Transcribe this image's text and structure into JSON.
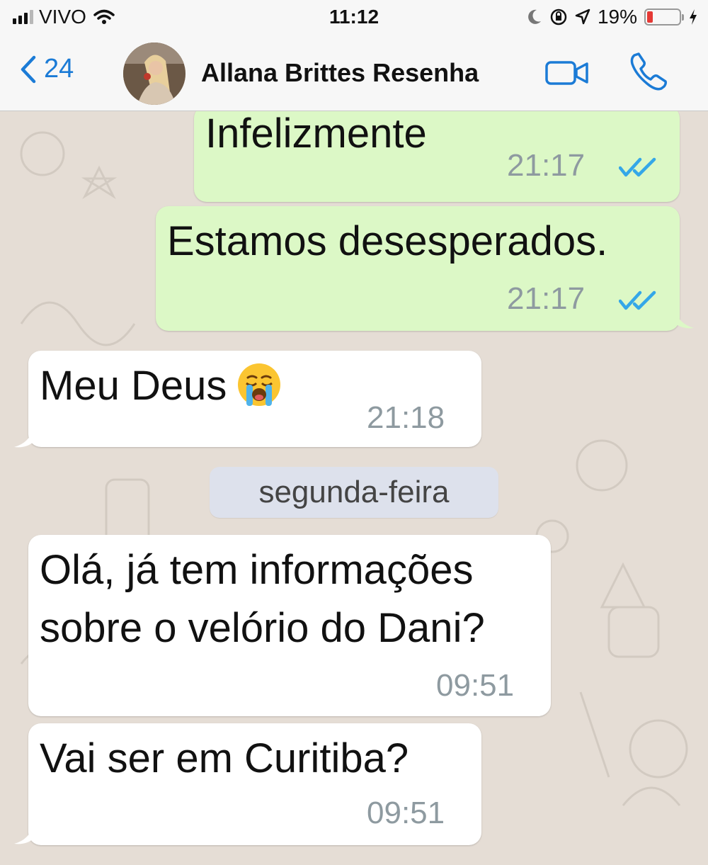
{
  "status_bar": {
    "carrier": "VIVO",
    "time": "11:12",
    "battery_percent": "19%",
    "battery_level": 0.19,
    "icons": [
      "signal-icon",
      "wifi-icon",
      "moon-icon",
      "orientation-lock-icon",
      "location-icon",
      "battery-icon",
      "charging-icon"
    ]
  },
  "header": {
    "back_count": "24",
    "contact_name": "Allana Brittes Resenha",
    "icons": [
      "back-chevron-icon",
      "avatar",
      "video-call-icon",
      "phone-call-icon"
    ]
  },
  "messages": [
    {
      "direction": "outgoing",
      "text": "Infelizmente",
      "time": "21:17",
      "status": "read"
    },
    {
      "direction": "outgoing",
      "text": "Estamos desesperados.",
      "time": "21:17",
      "status": "read"
    },
    {
      "direction": "incoming",
      "text": "Meu Deus",
      "emoji": "loudly-crying-face",
      "time": "21:18"
    },
    {
      "direction": "incoming",
      "text_line1": "Olá, já tem informações",
      "text_line2": "sobre o velório do Dani?",
      "time": "09:51"
    },
    {
      "direction": "incoming",
      "text": "Vai ser em Curitiba?",
      "time": "09:51"
    }
  ],
  "date_separator": "segunda-feira",
  "colors": {
    "outgoing_bubble": "#dcf8c6",
    "incoming_bubble": "#ffffff",
    "accent": "#1b7bd6",
    "read_ticks": "#34a7e8",
    "chat_background": "#e5ddd5"
  }
}
